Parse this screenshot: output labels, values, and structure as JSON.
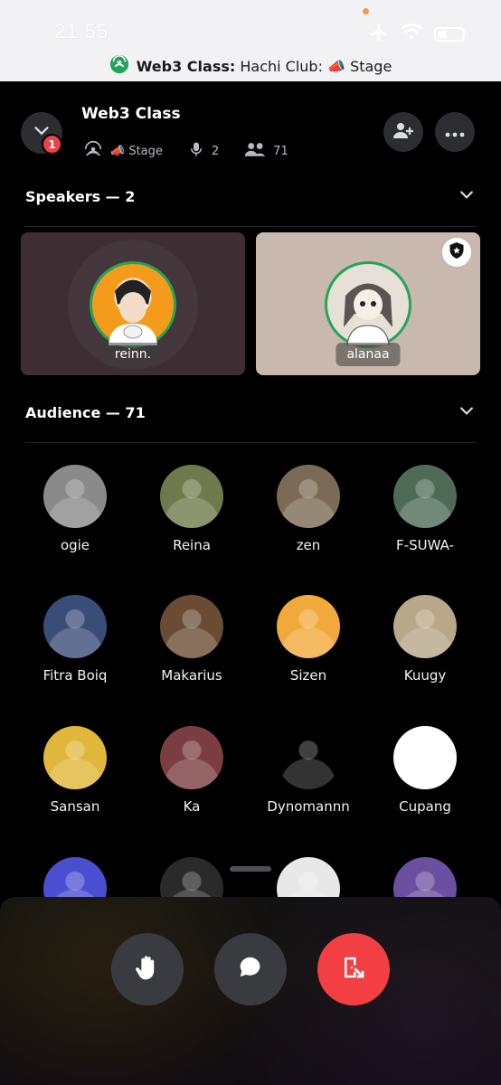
{
  "status_bar": {
    "time": "21.55"
  },
  "stage_banner": {
    "bold": "Web3 Class:",
    "text": "Hachi Club: 📣 Stage"
  },
  "header": {
    "notification_count": "1",
    "channel_title": "Web3 Class",
    "stage_label": "📣 Stage",
    "speaker_count": "2",
    "listener_count": "71"
  },
  "speakers": {
    "heading": "Speakers — 2",
    "items": [
      {
        "name": "reinn."
      },
      {
        "name": "alanaa"
      }
    ]
  },
  "audience": {
    "heading": "Audience — 71",
    "members": [
      {
        "name": "ogie",
        "color": "#8a8a8a"
      },
      {
        "name": "Reina",
        "color": "#6f7a4c"
      },
      {
        "name": "zen",
        "color": "#7b6a55"
      },
      {
        "name": "F-SUWA-",
        "color": "#4f6a56"
      },
      {
        "name": "Fitra Boiq",
        "color": "#3a4d78"
      },
      {
        "name": "Makarius",
        "color": "#6a4c34"
      },
      {
        "name": "Sizen",
        "color": "#f2a93b"
      },
      {
        "name": "Kuugy",
        "color": "#b8a788"
      },
      {
        "name": "Sansan",
        "color": "#e0b73a"
      },
      {
        "name": "Ka",
        "color": "#7a3d41"
      },
      {
        "name": "Dynomannn",
        "color": "#000000"
      },
      {
        "name": "Cupang",
        "color": "#ffffff"
      },
      {
        "name": "",
        "color": "#4a4fd1"
      },
      {
        "name": "",
        "color": "#2a2a2a"
      },
      {
        "name": "",
        "color": "#e8e8e8"
      },
      {
        "name": "",
        "color": "#6b4fa0"
      }
    ]
  }
}
